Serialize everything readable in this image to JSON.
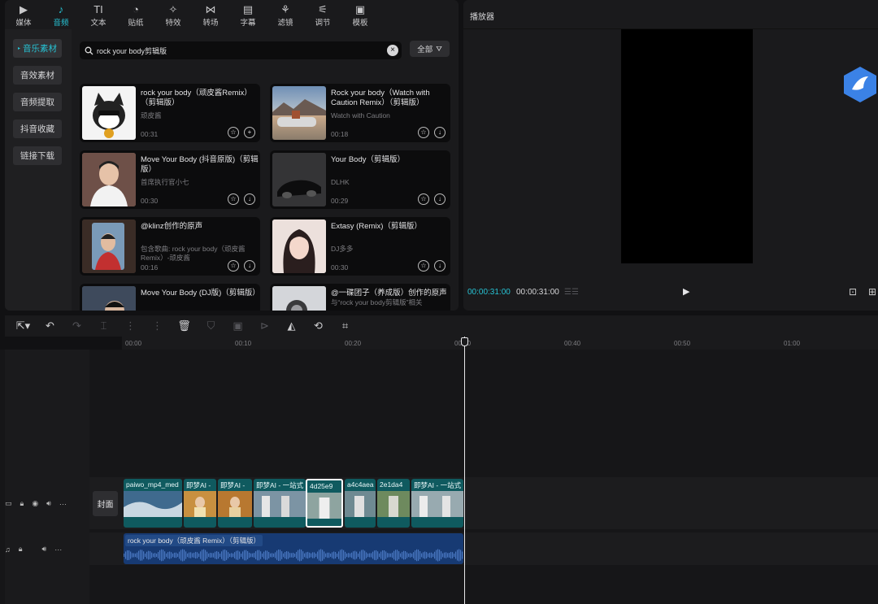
{
  "toolbar": [
    {
      "label": "媒体",
      "icon": "▶"
    },
    {
      "label": "音频",
      "icon": "♪"
    },
    {
      "label": "文本",
      "icon": "TI"
    },
    {
      "label": "贴纸",
      "icon": "◔"
    },
    {
      "label": "特效",
      "icon": "✧"
    },
    {
      "label": "转场",
      "icon": "⋈"
    },
    {
      "label": "字幕",
      "icon": "▤"
    },
    {
      "label": "滤镜",
      "icon": "⚘"
    },
    {
      "label": "调节",
      "icon": "⚟"
    },
    {
      "label": "模板",
      "icon": "▣"
    }
  ],
  "categories": [
    "音乐素材",
    "音效素材",
    "音频提取",
    "抖音收藏",
    "链接下载"
  ],
  "search": {
    "query": "rock your body剪辑版",
    "filter_label": "全部"
  },
  "cards": [
    {
      "title": "rock your body（顽皮酱Remix）（剪辑版）",
      "artist": "顽皮酱",
      "duration": "00:31",
      "action": "+"
    },
    {
      "title": "Rock your body（Watch with Caution Remix）（剪辑版）",
      "artist": "Watch with Caution",
      "duration": "00:18",
      "action": "↓"
    },
    {
      "title": "Move Your Body (抖音原版)（剪辑版）",
      "artist": "首席执行官小七",
      "duration": "00:30",
      "action": "↓"
    },
    {
      "title": "Your Body（剪辑版）",
      "artist": "DLHK",
      "duration": "00:29",
      "action": "↓"
    },
    {
      "title": "@klinz创作的原声",
      "artist": "包含歌曲: rock your body（顽皮酱Remix）-顽皮酱",
      "duration": "00:16",
      "action": "↓"
    },
    {
      "title": "Extasy (Remix)（剪辑版）",
      "artist": "DJ多多",
      "duration": "00:30",
      "action": "↓"
    },
    {
      "title": "Move Your Body (DJ版)（剪辑版）",
      "artist": "",
      "duration": "",
      "action": ""
    },
    {
      "title": "@一碟团子（养成版）创作的原声",
      "artist": "与“rock your body剪辑版”相关",
      "duration": "",
      "action": ""
    }
  ],
  "player": {
    "title": "播放器",
    "current_time": "00:00:31:00",
    "total_time": "00:00:31:00"
  },
  "ruler": [
    "00:00",
    "00:10",
    "00:20",
    "00:30",
    "00:40",
    "00:50",
    "01:00"
  ],
  "cover_label": "封面",
  "clips": [
    {
      "label": "paiwo_mp4_med"
    },
    {
      "label": "即梦AI -"
    },
    {
      "label": "即梦AI -"
    },
    {
      "label": "即梦AI - 一站式"
    },
    {
      "label": "4d25e9"
    },
    {
      "label": "a4c4aea"
    },
    {
      "label": "2e1da4"
    },
    {
      "label": "即梦AI - 一站式"
    }
  ],
  "audio_clip": {
    "label": "rock your body（顽皮酱 Remix）（剪辑版）"
  },
  "colors": {
    "accent": "#27c3d4",
    "video_clip": "#0f5a5f",
    "audio_clip": "#173a73"
  }
}
